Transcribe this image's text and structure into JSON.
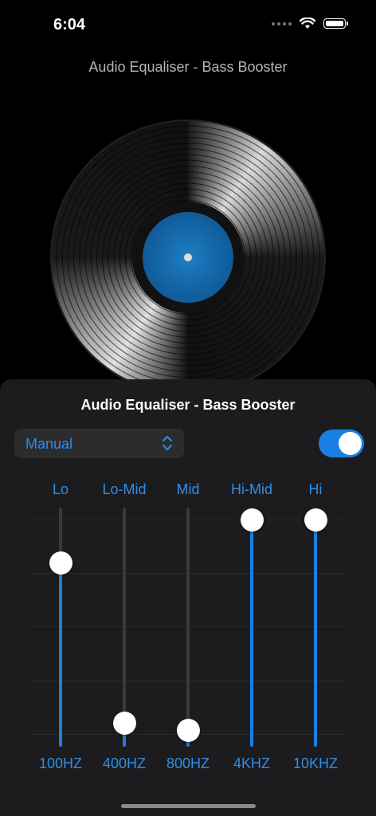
{
  "status_bar": {
    "time": "6:04"
  },
  "app_title": "Audio Equaliser - Bass Booster",
  "panel": {
    "title": "Audio Equaliser - Bass Booster",
    "preset": {
      "value": "Manual",
      "icon": "chevron-updown-icon"
    },
    "enabled": true
  },
  "bands": [
    {
      "name": "Lo",
      "freq": "100HZ",
      "level": 0.77
    },
    {
      "name": "Lo-Mid",
      "freq": "400HZ",
      "level": 0.1
    },
    {
      "name": "Mid",
      "freq": "800HZ",
      "level": 0.07
    },
    {
      "name": "Hi-Mid",
      "freq": "4KHZ",
      "level": 0.95
    },
    {
      "name": "Hi",
      "freq": "10KHZ",
      "level": 0.95
    }
  ],
  "colors": {
    "accent": "#1a7fe0",
    "label": "#2f8ee6",
    "panel": "#1c1c1e",
    "record_label": "#1d7fc4"
  }
}
